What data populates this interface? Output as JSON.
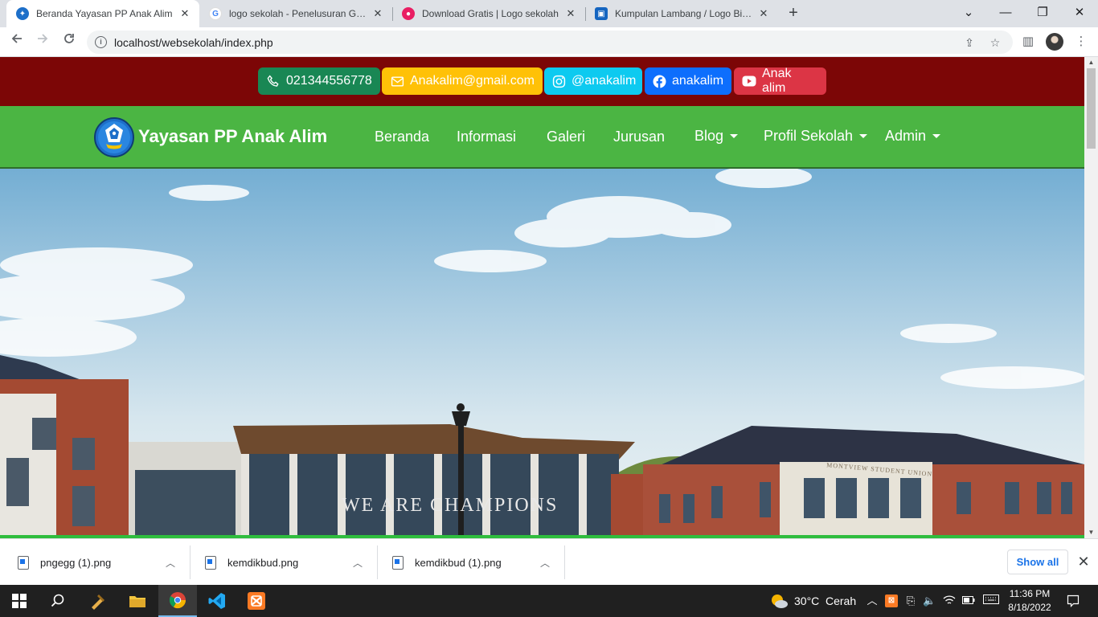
{
  "browser": {
    "tabs": [
      {
        "title": "Beranda Yayasan PP Anak Alim",
        "active": true,
        "icon": "kemdikbud-icon"
      },
      {
        "title": "logo sekolah - Penelusuran Goog",
        "active": false,
        "icon": "google-icon"
      },
      {
        "title": "Download Gratis | Logo sekolah",
        "active": false,
        "icon": "pngegg-icon"
      },
      {
        "title": "Kumpulan Lambang / Logo Bidar",
        "active": false,
        "icon": "site-icon"
      }
    ],
    "url": "localhost/websekolah/index.php",
    "downloads": [
      {
        "name": "pngegg (1).png"
      },
      {
        "name": "kemdikbud.png"
      },
      {
        "name": "kemdikbud (1).png"
      }
    ],
    "show_all_label": "Show all"
  },
  "contact": {
    "phone": "021344556778",
    "email": "Anakalim@gmail.com",
    "instagram": "@anakalim",
    "facebook": "anakalim",
    "youtube": "Anak alim",
    "colors": {
      "bar": "#7c0606",
      "phone": "#198754",
      "email": "#ffc107",
      "instagram": "#0dcaf0",
      "facebook": "#0d6efd",
      "youtube": "#dc3545"
    }
  },
  "navbar": {
    "brand": "Yayasan PP Anak Alim",
    "color": "#4bb543",
    "links": [
      {
        "label": "Beranda"
      },
      {
        "label": "Informasi"
      },
      {
        "label": "Galeri"
      },
      {
        "label": "Jurusan"
      },
      {
        "label": "Blog",
        "dropdown": true
      },
      {
        "label": "Profil Sekolah",
        "dropdown": true
      },
      {
        "label": "Admin",
        "dropdown": true
      }
    ]
  },
  "hero": {
    "sign_text": "WE ARE CHAMPIONS",
    "building_sign": "MONTVIEW STUDENT UNION"
  },
  "taskbar": {
    "weather_temp": "30°C",
    "weather_text": "Cerah",
    "time": "11:36 PM",
    "date": "8/18/2022"
  }
}
